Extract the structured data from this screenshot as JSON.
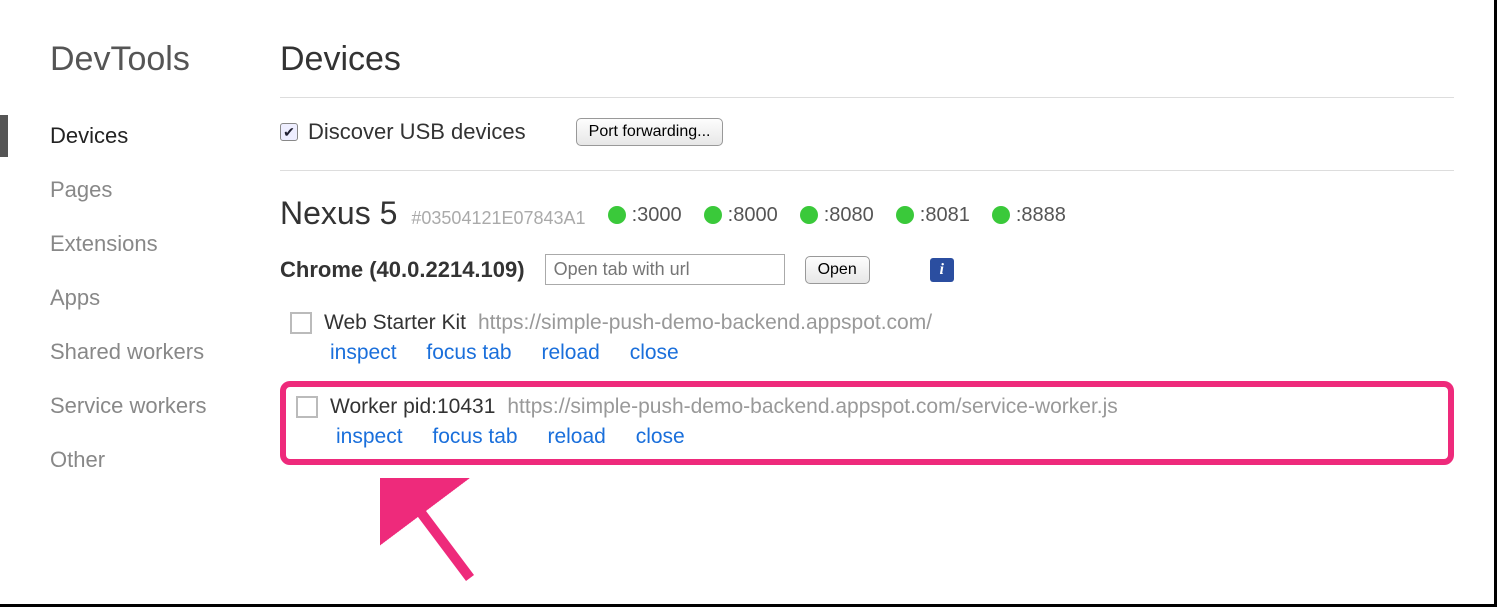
{
  "sidebar": {
    "title": "DevTools",
    "items": [
      {
        "label": "Devices",
        "active": true
      },
      {
        "label": "Pages",
        "active": false
      },
      {
        "label": "Extensions",
        "active": false
      },
      {
        "label": "Apps",
        "active": false
      },
      {
        "label": "Shared workers",
        "active": false
      },
      {
        "label": "Service workers",
        "active": false
      },
      {
        "label": "Other",
        "active": false
      }
    ]
  },
  "page": {
    "title": "Devices",
    "discover_label": "Discover USB devices",
    "discover_checked": true,
    "port_forwarding_button": "Port forwarding..."
  },
  "device": {
    "name": "Nexus 5",
    "id": "#03504121E07843A1",
    "ports": [
      ":3000",
      ":8000",
      ":8080",
      ":8081",
      ":8888"
    ]
  },
  "browser": {
    "label": "Chrome (40.0.2214.109)",
    "url_placeholder": "Open tab with url",
    "open_button": "Open"
  },
  "targets": [
    {
      "title": "Web Starter Kit",
      "url": "https://simple-push-demo-backend.appspot.com/",
      "actions": [
        "inspect",
        "focus tab",
        "reload",
        "close"
      ],
      "highlighted": false
    },
    {
      "title": "Worker pid:10431",
      "url": "https://simple-push-demo-backend.appspot.com/service-worker.js",
      "actions": [
        "inspect",
        "focus tab",
        "reload",
        "close"
      ],
      "highlighted": true
    }
  ]
}
